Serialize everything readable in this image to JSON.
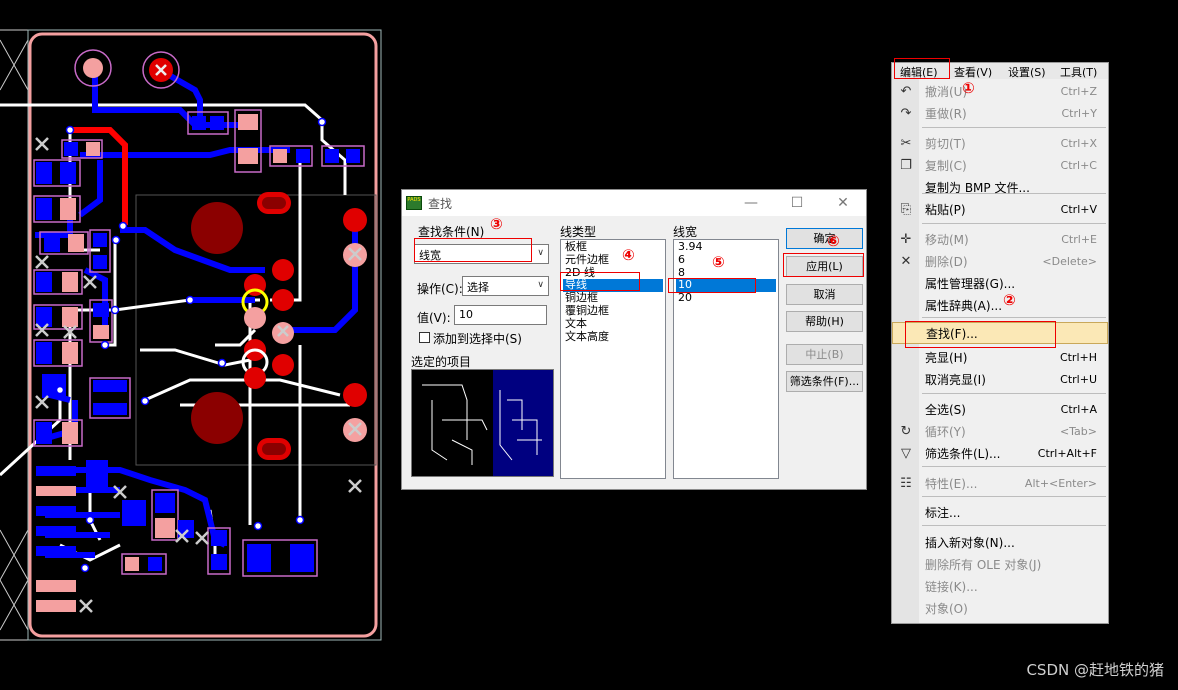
{
  "dialog": {
    "title": "查找",
    "criteria_label": "查找条件(N)",
    "criteria_value": "线宽",
    "action_label": "操作(C):",
    "action_value": "选择",
    "value_label": "值(V):",
    "value_input": "10",
    "add_to_selection": "添加到选择中(S)",
    "selected_items_label": "选定的项目",
    "line_type_header": "线类型",
    "line_types": [
      "板框",
      "元件边框",
      "2D 线",
      "导线",
      "铜边框",
      "覆铜边框",
      "文本",
      "文本高度"
    ],
    "selected_line_type": "导线",
    "line_width_header": "线宽",
    "line_widths": [
      "3.94",
      "6",
      "8",
      "10",
      "20"
    ],
    "selected_line_width": "10",
    "buttons": {
      "ok": "确定",
      "apply": "应用(L)",
      "cancel": "取消",
      "help": "帮助(H)",
      "stop": "中止(B)",
      "filter": "筛选条件(F)..."
    }
  },
  "menu": {
    "menubar": [
      "编辑(E)",
      "查看(V)",
      "设置(S)",
      "工具(T)"
    ],
    "items": [
      {
        "label": "撤消(U)",
        "shortcut": "Ctrl+Z",
        "disabled": true,
        "icon": "undo-icon"
      },
      {
        "label": "重做(R)",
        "shortcut": "Ctrl+Y",
        "disabled": true,
        "icon": "redo-icon"
      },
      {
        "label": "剪切(T)",
        "shortcut": "Ctrl+X",
        "disabled": true,
        "icon": "scissors-icon"
      },
      {
        "label": "复制(C)",
        "shortcut": "Ctrl+C",
        "disabled": true,
        "icon": "copy-icon"
      },
      {
        "label": "复制为 BMP 文件...",
        "shortcut": "",
        "disabled": false,
        "icon": ""
      },
      {
        "label": "粘贴(P)",
        "shortcut": "Ctrl+V",
        "disabled": false,
        "icon": "paste-icon"
      },
      {
        "label": "移动(M)",
        "shortcut": "Ctrl+E",
        "disabled": true,
        "icon": "move-icon"
      },
      {
        "label": "删除(D)",
        "shortcut": "<Delete>",
        "disabled": true,
        "icon": "delete-icon"
      },
      {
        "label": "属性管理器(G)...",
        "shortcut": "",
        "disabled": false,
        "icon": ""
      },
      {
        "label": "属性辞典(A)...",
        "shortcut": "",
        "disabled": false,
        "icon": ""
      },
      {
        "label": "查找(F)...",
        "shortcut": "",
        "disabled": false,
        "icon": ""
      },
      {
        "label": "亮显(H)",
        "shortcut": "Ctrl+H",
        "disabled": false,
        "icon": ""
      },
      {
        "label": "取消亮显(I)",
        "shortcut": "Ctrl+U",
        "disabled": false,
        "icon": ""
      },
      {
        "label": "全选(S)",
        "shortcut": "Ctrl+A",
        "disabled": false,
        "icon": ""
      },
      {
        "label": "循环(Y)",
        "shortcut": "<Tab>",
        "disabled": true,
        "icon": "cycle-icon"
      },
      {
        "label": "筛选条件(L)...",
        "shortcut": "Ctrl+Alt+F",
        "disabled": false,
        "icon": "filter-icon"
      },
      {
        "label": "特性(E)...",
        "shortcut": "Alt+<Enter>",
        "disabled": true,
        "icon": "properties-icon"
      },
      {
        "label": "标注...",
        "shortcut": "",
        "disabled": false,
        "icon": ""
      },
      {
        "label": "插入新对象(N)...",
        "shortcut": "",
        "disabled": false,
        "icon": ""
      },
      {
        "label": "删除所有 OLE 对象(J)",
        "shortcut": "",
        "disabled": true,
        "icon": ""
      },
      {
        "label": "链接(K)...",
        "shortcut": "",
        "disabled": true,
        "icon": ""
      },
      {
        "label": "对象(O)",
        "shortcut": "",
        "disabled": true,
        "icon": ""
      }
    ]
  },
  "annotations": [
    "①",
    "②",
    "③",
    "④",
    "⑤",
    "⑥"
  ],
  "watermark": "CSDN @赶地铁的猪",
  "colors": {
    "board_outline": "#f4a0a0",
    "trace_white": "#ffffff",
    "trace_blue": "#0000ff",
    "trace_red": "#ff0000",
    "pad_red": "#e00000",
    "pad_pink": "#f4a0a0",
    "highlight_yellow": "#ffff00",
    "annotation_red": "#ee0000"
  }
}
